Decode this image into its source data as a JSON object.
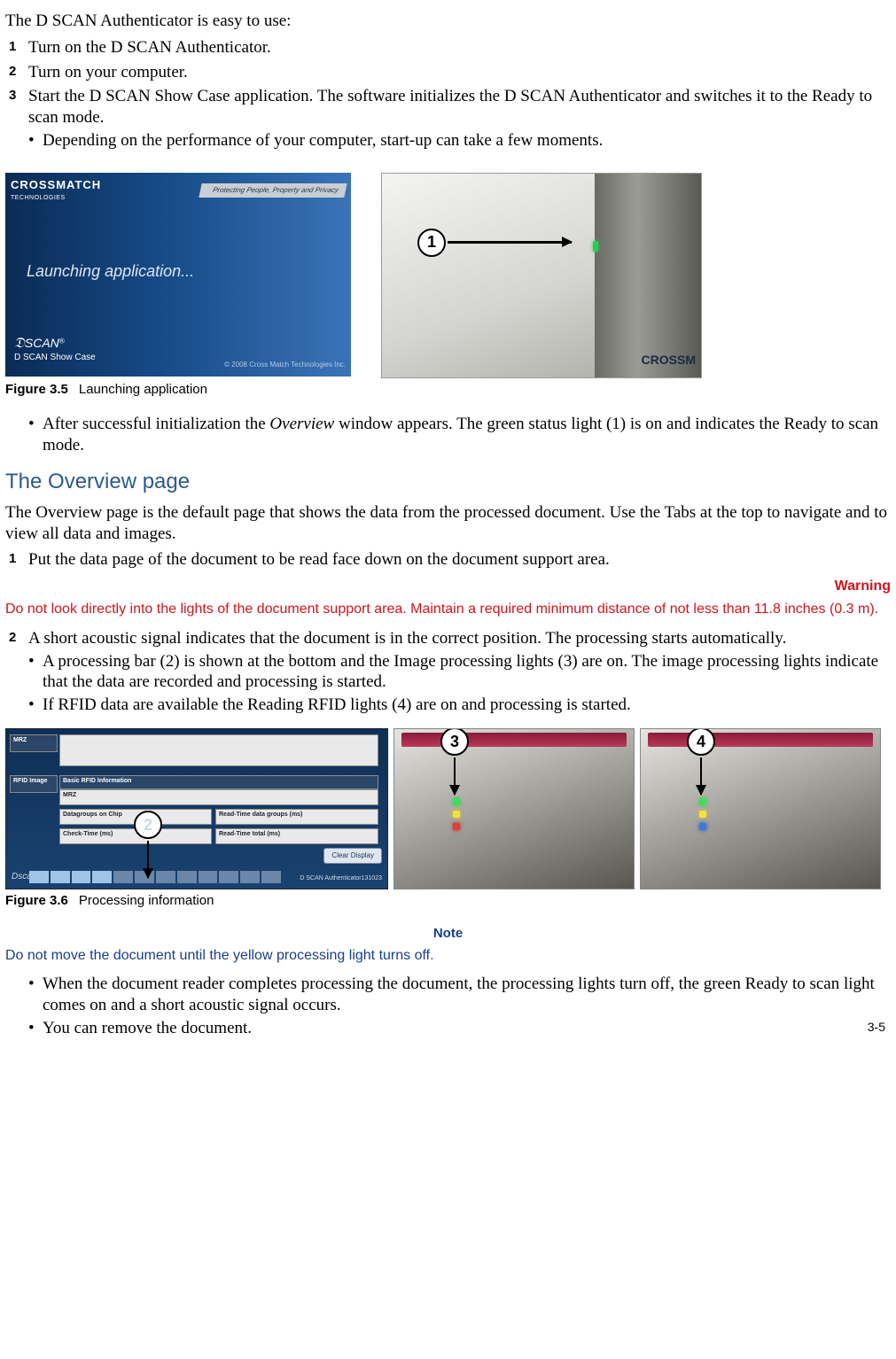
{
  "intro": "The D SCAN Authenticator is easy to use:",
  "steps_a": [
    "Turn on the D SCAN Authenticator.",
    "Turn on your computer.",
    "Start the D SCAN Show Case application. The software initializes the D SCAN Authenticator and switches it to the Ready to scan mode."
  ],
  "steps_a_sub": [
    "Depending on the performance of your computer, start-up can take a few moments."
  ],
  "splash": {
    "brand_top": "CROSSMATCH",
    "brand_sub": "TECHNOLOGIES",
    "ribbon": "Protecting People, Property and Privacy",
    "center": "Launching application...",
    "logo_line1": "D SCAN®",
    "logo_line2": "D SCAN Show Case",
    "copyright": "© 2008 Cross Match Technologies Inc."
  },
  "device_label_right": "CROSSM",
  "callout1": "1",
  "fig35_num": "Figure 3.5",
  "fig35_cap": "Launching application",
  "after_init_pre": "After successful initialization the ",
  "after_init_italic": "Overview",
  "after_init_post": " window appears. The green status light (1) is on and indicates the Ready to scan mode.",
  "section_overview": "The Overview page",
  "overview_para": "The Overview page is the default page that shows the data from the processed document. Use the Tabs at the top to navigate and to view all data and images.",
  "steps_b": [
    "Put the data page of the document to be read face down on the document support area."
  ],
  "warning_label": "Warning",
  "warning_text": "Do not look directly into the lights of the document support area. Maintain a required minimum distance of not less than 11.8 inches (0.3 m).",
  "steps_c": [
    "A short acoustic signal indicates that the document is in the correct position. The processing starts automatically."
  ],
  "steps_c_sub": [
    "A processing bar (2) is shown at the bottom and the Image processing lights (3) are on. The image processing lights indicate that the data are recorded and processing is started.",
    "If RFID data are available the Reading RFID lights (4) are on and processing is started."
  ],
  "fig6": {
    "mrz": "MRZ",
    "rfid_image": "RFID Image",
    "basic_rfid": "Basic RFID Information",
    "datagroups": "Datagroups on Chip",
    "readtime_dg": "Read-Time data groups (ms)",
    "checktime": "Check-Time (ms)",
    "readtime_total": "Read-Time total (ms)",
    "clear": "Clear Display",
    "brand": "D SCAN Authenticator131023",
    "logo": "Dscan"
  },
  "callout2": "2",
  "callout3": "3",
  "callout4": "4",
  "fig36_num": "Figure 3.6",
  "fig36_cap": "Processing information",
  "note_label": "Note",
  "note_text": "Do not move the document until the yellow processing light turns off.",
  "final_bullets": [
    "When the document reader completes processing the document, the processing lights turn off, the green Ready to scan light comes on and a short acoustic signal occurs.",
    "You can remove the document."
  ],
  "page_number": "3-5"
}
